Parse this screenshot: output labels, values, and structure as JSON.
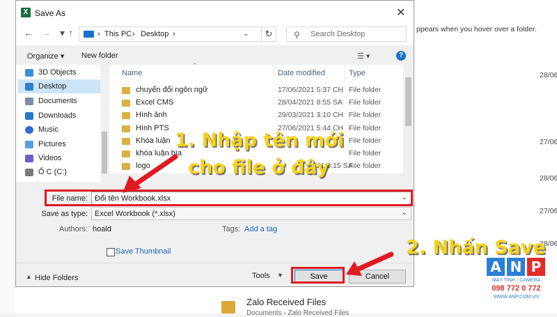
{
  "background": {
    "hover_hint": "ppears when you hover over a folder.",
    "dates": [
      "28/06",
      "27/06",
      "27/06",
      "28/06",
      "28/06"
    ],
    "folder_title": "Zalo Received Files",
    "folder_sub": "Documents › Zalo Received Files"
  },
  "dialog": {
    "title": "Save As",
    "app_icon": "X",
    "close_glyph": "✕"
  },
  "nav": {
    "back": "←",
    "forward": "→",
    "up": "↑",
    "crumbs": [
      "This PC",
      "Desktop"
    ],
    "crumb_sep": "›",
    "refresh": "↻",
    "search_placeholder": "Search Desktop"
  },
  "toolbar": {
    "organize": "Organize ▾",
    "new_folder": "New folder",
    "view": "☰ ▾",
    "help": "?"
  },
  "sidebar": {
    "items": [
      {
        "label": "3D Objects",
        "color": "#3a8fd8"
      },
      {
        "label": "Desktop",
        "color": "#2f7fd0",
        "selected": true
      },
      {
        "label": "Documents",
        "color": "#7b8da6"
      },
      {
        "label": "Downloads",
        "color": "#2b78c9"
      },
      {
        "label": "Music",
        "color": "#2f6fd0"
      },
      {
        "label": "Pictures",
        "color": "#5aa0e0"
      },
      {
        "label": "Videos",
        "color": "#6b5fc9"
      },
      {
        "label": "Ổ C (C:)",
        "color": "#7a7a7a"
      }
    ]
  },
  "columns": {
    "name": "Name",
    "date": "Date modified",
    "type": "Type"
  },
  "files": [
    {
      "name": "chuyển đổi ngôn ngữ",
      "date": "17/06/2021 5:37 CH",
      "type": "File folder"
    },
    {
      "name": "Excel CMS",
      "date": "28/04/2021 8:55 SA",
      "type": "File folder"
    },
    {
      "name": "Hình ảnh",
      "date": "29/03/2021 3:10 CH",
      "type": "File folder"
    },
    {
      "name": "Hình PTS",
      "date": "27/06/2021 5:44 CH",
      "type": "File folder"
    },
    {
      "name": "Khóa luận",
      "date": "",
      "type": "File folder"
    },
    {
      "name": "khóa luận bìa",
      "date": "",
      "type": "File folder"
    },
    {
      "name": "logo",
      "date": "2021 8:15 SA",
      "type": "File folder"
    }
  ],
  "form": {
    "file_name_label": "File name:",
    "file_name_value": "Đổi tên Workbook.xlsx",
    "save_type_label": "Save as type:",
    "save_type_value": "Excel Workbook (*.xlsx)",
    "authors_label": "Authors:",
    "authors_value": "hoald",
    "tags_label": "Tags:",
    "tags_value": "Add a tag",
    "thumbnail_label": "Save Thumbnail"
  },
  "footer": {
    "hide_folders": "Hide Folders",
    "tools": "Tools",
    "save": "Save",
    "cancel": "Cancel"
  },
  "annotations": {
    "step1_line1": "1. Nhập tên mới",
    "step1_line2": "cho file ở đây",
    "step2": "2. Nhấn Save",
    "highlight_color": "#e01a22",
    "text_color": "#f7d21a"
  },
  "logo": {
    "letters": [
      "A",
      "N",
      "P"
    ],
    "tagline": "MÁY TÍNH - CAMERA",
    "phone": "098 772 0 772",
    "site": "WWW.ANP.COM.VN"
  }
}
